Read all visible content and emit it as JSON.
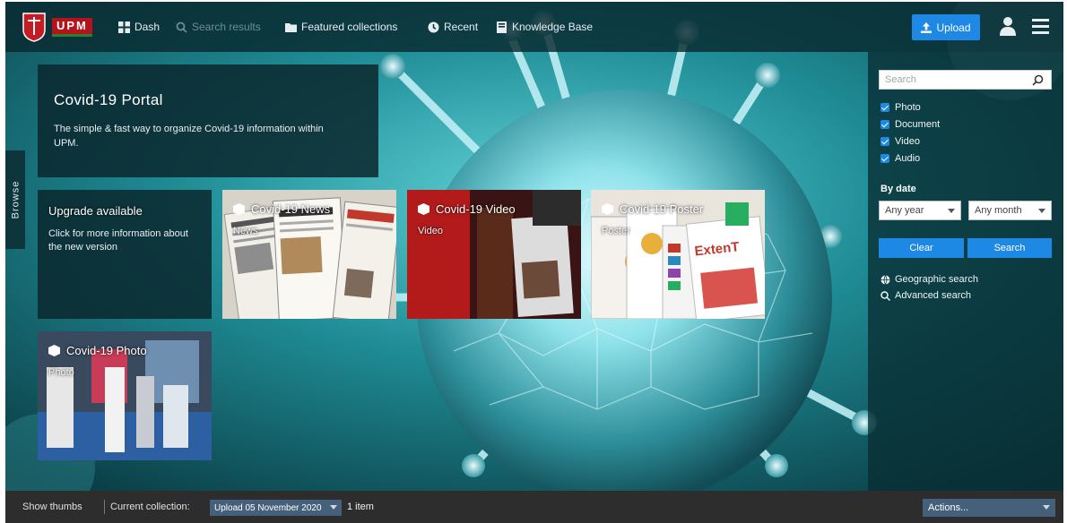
{
  "header": {
    "logo_text": "UPM",
    "nav": [
      {
        "label": "Dash",
        "icon": "grid-icon"
      },
      {
        "label": "Search results",
        "icon": "search-icon"
      },
      {
        "label": "Featured collections",
        "icon": "folder-icon"
      },
      {
        "label": "Recent",
        "icon": "clock-icon"
      },
      {
        "label": "Knowledge Base",
        "icon": "book-icon"
      }
    ],
    "upload_label": "Upload"
  },
  "browse_tab": "Browse",
  "portal": {
    "title": "Covid-19 Portal",
    "description": "The simple & fast way to organize Covid-19 information within UPM."
  },
  "tiles": {
    "upgrade": {
      "title": "Upgrade available",
      "text": "Click for more information about the new version"
    },
    "news": {
      "title": "Covid-19 News",
      "subtitle": "News"
    },
    "video": {
      "title": "Covid-19 Video",
      "subtitle": "Video"
    },
    "poster": {
      "title": "Covid-19 Poster",
      "subtitle": "Poster",
      "poster_word": "ExtenT"
    },
    "photo": {
      "title": "Covid-19 Photo",
      "subtitle": "Photo"
    }
  },
  "search_panel": {
    "placeholder": "Search",
    "types": [
      "Photo",
      "Document",
      "Video",
      "Audio"
    ],
    "by_date_label": "By date",
    "year_select": "Any year",
    "month_select": "Any month",
    "clear_label": "Clear",
    "search_label": "Search",
    "geo_search": "Geographic search",
    "advanced_search": "Advanced search"
  },
  "footer": {
    "show_thumbs": "Show thumbs",
    "current_collection_label": "Current collection:",
    "collection_value": "Upload 05 November 2020",
    "item_count": "1 item",
    "actions_label": "Actions..."
  },
  "colors": {
    "accent": "#1e88e5",
    "header_bg": "#082a30",
    "footer_bg": "#2d2d2d",
    "brand_red": "#b3141b"
  }
}
